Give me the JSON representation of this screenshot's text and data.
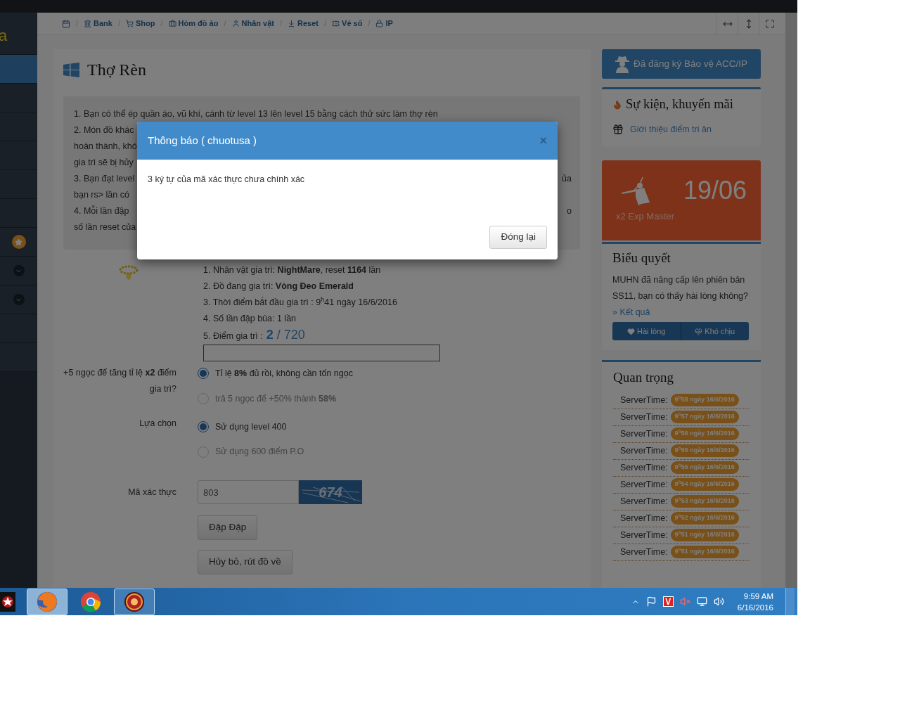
{
  "sidebar": {
    "items": [
      {
        "kind": "text",
        "label": "a",
        "selected": false
      },
      {
        "kind": "plain",
        "selected": true
      },
      {
        "kind": "plain",
        "selected": false
      },
      {
        "kind": "plain",
        "selected": false
      },
      {
        "kind": "plain",
        "selected": false
      },
      {
        "kind": "plain",
        "selected": false
      },
      {
        "kind": "plain",
        "selected": false
      },
      {
        "kind": "star",
        "selected": false
      },
      {
        "kind": "chevron",
        "selected": false
      },
      {
        "kind": "chevron",
        "selected": false
      },
      {
        "kind": "plain",
        "selected": false
      },
      {
        "kind": "plain",
        "selected": false
      }
    ]
  },
  "breadcrumb": {
    "separator": "/",
    "items": [
      {
        "kind": "calendar"
      },
      {
        "kind": "bank",
        "label": "Bank"
      },
      {
        "kind": "cart",
        "label": "Shop"
      },
      {
        "kind": "case",
        "label": "Hòm đồ ảo"
      },
      {
        "kind": "user",
        "label": "Nhân vật"
      },
      {
        "kind": "reset",
        "label": "Reset"
      },
      {
        "kind": "ticket",
        "label": "Vé số"
      },
      {
        "kind": "lock",
        "label": "IP"
      }
    ]
  },
  "view_controls": [
    {
      "kind": "width"
    },
    {
      "kind": "height"
    },
    {
      "kind": "fullscreen"
    }
  ],
  "page": {
    "title": "Thợ Rèn",
    "rules": [
      {
        "left": "1. Bạn có thể ép quần áo, vũ khí, cánh từ level 13 lên level 15 bằng cách thử sức làm thợ rèn"
      },
      {
        "left": "2. Món đồ khác"
      },
      {
        "left": "hoàn thành, khó"
      },
      {
        "left": "gia trì sẽ bị hủy"
      },
      {
        "left": "3. Bạn đạt level",
        "right": "ủa"
      },
      {
        "left": "bạn rs> lần có"
      },
      {
        "left": "4. Mỗi lần đập",
        "right": "o"
      },
      {
        "left": "số lần reset của"
      }
    ],
    "details": [
      "1. Nhân vật gia trì: **NightMare**, reset **1164** lần",
      "2. Đồ đang gia trì: **Vòng Đeo Emerald**",
      "3. Thời điểm bắt đầu gia trì : 9$^{h}$41 ngày 16/6/2016",
      "4. Số lần đập búa: 1 lần"
    ],
    "score": {
      "label": "5. Điểm gia trì :",
      "value": "2",
      "total": "/ 720"
    },
    "progress": {
      "level": 0
    },
    "options": [
      {
        "label": "+5 ngọc để tăng tỉ lệ **x2** điểm gia trì?",
        "choices": [
          {
            "text": "Tỉ lệ **8%** đủ rồi, không cần tốn ngọc",
            "selected": true
          },
          {
            "text": "trả 5 ngọc để +50% thành **58%**",
            "selected": false
          }
        ]
      },
      {
        "label": "Lựa chọn",
        "choices": [
          {
            "text": "Sử dụng level 400",
            "selected": true
          },
          {
            "text": "Sử dụng 600 điểm P.O",
            "selected": false
          }
        ]
      }
    ],
    "captcha": {
      "label": "Mã xác thực",
      "value": "803",
      "code": "674"
    },
    "actions": [
      "Đập Đập",
      "Hủy bỏ, rút đồ về"
    ]
  },
  "modal": {
    "title": "Thông báo ( chuotusa )",
    "close": "×",
    "message": "3 ký tự của mã xác thực chưa chính xác",
    "button": "Đóng lại"
  },
  "right": {
    "protect_button": "Đã đăng ký Bảo vệ ACC/IP",
    "events": {
      "title": "Sự kiện, khuyến mãi",
      "link": "Giới thiệu điểm tri ân"
    },
    "promo": {
      "date": "19/06",
      "caption": "x2 Exp Master"
    },
    "poll": {
      "title": "Biểu quyết",
      "question": "MUHN đã nâng cấp lên phiên bản SS11, bạn có thấy hài lòng không?",
      "result_link": "» Kết quả",
      "options": [
        {
          "kind": "like",
          "label": "Hài lòng"
        },
        {
          "kind": "dislike",
          "label": "Khó chịu"
        }
      ]
    },
    "important": {
      "title": "Quan trọng",
      "items": [
        {
          "label": "ServerTime:",
          "time": "9$^{h}$58 ngày 16/6/2016"
        },
        {
          "label": "ServerTime:",
          "time": "9$^{h}$57 ngày 16/6/2016"
        },
        {
          "label": "ServerTime:",
          "time": "9$^{h}$56 ngày 16/6/2016"
        },
        {
          "label": "ServerTime:",
          "time": "9$^{h}$56 ngày 16/6/2016"
        },
        {
          "label": "ServerTime:",
          "time": "9$^{h}$55 ngày 16/6/2016"
        },
        {
          "label": "ServerTime:",
          "time": "9$^{h}$54 ngày 16/6/2016"
        },
        {
          "label": "ServerTime:",
          "time": "9$^{h}$53 ngày 16/6/2016"
        },
        {
          "label": "ServerTime:",
          "time": "9$^{h}$52 ngày 16/6/2016"
        },
        {
          "label": "ServerTime:",
          "time": "9$^{h}$51 ngày 16/6/2016"
        },
        {
          "label": "ServerTime:",
          "time": "9$^{h}$51 ngày 16/6/2016"
        }
      ]
    }
  },
  "taskbar": {
    "apps": [
      {
        "kind": "fox",
        "open": true,
        "selected": true
      },
      {
        "kind": "globe",
        "open": false,
        "selected": false
      },
      {
        "kind": "game",
        "open": true,
        "selected": false
      }
    ],
    "tray": [
      {
        "kind": "up"
      },
      {
        "kind": "flag"
      },
      {
        "kind": "badge",
        "text": "V"
      },
      {
        "kind": "speaker_off"
      },
      {
        "kind": "network"
      },
      {
        "kind": "volume"
      }
    ],
    "time": "9:59 AM",
    "date": "6/16/2016"
  }
}
